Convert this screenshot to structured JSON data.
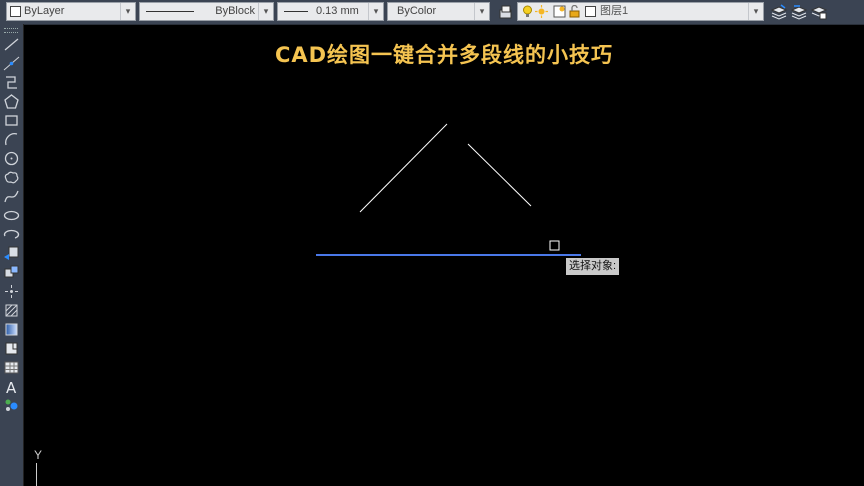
{
  "toolbar": {
    "layer_combo": "ByLayer",
    "linetype_combo": "ByBlock",
    "lineweight_combo": "0.13 mm",
    "color_combo": "ByColor",
    "current_layer": "图层1"
  },
  "drawing": {
    "title": "CAD绘图一键合并多段线的小技巧",
    "title_color": "#f5c451",
    "line_color": "#ffffff",
    "selected_line_color": "#4a78e8"
  },
  "cursor": {
    "prompt": "选择对象:"
  },
  "ucs": {
    "y_label": "Y"
  },
  "sidebar_tools": [
    "line-icon",
    "construction-line-icon",
    "polyline-icon",
    "polygon-icon",
    "rectangle-icon",
    "arc-icon",
    "circle-icon",
    "revision-cloud-icon",
    "spline-icon",
    "ellipse-icon",
    "ellipse-arc-icon",
    "insert-block-icon",
    "create-block-icon",
    "point-icon",
    "hatch-icon",
    "gradient-icon",
    "region-icon",
    "table-icon",
    "multiline-text-icon",
    "add-selected-icon"
  ]
}
